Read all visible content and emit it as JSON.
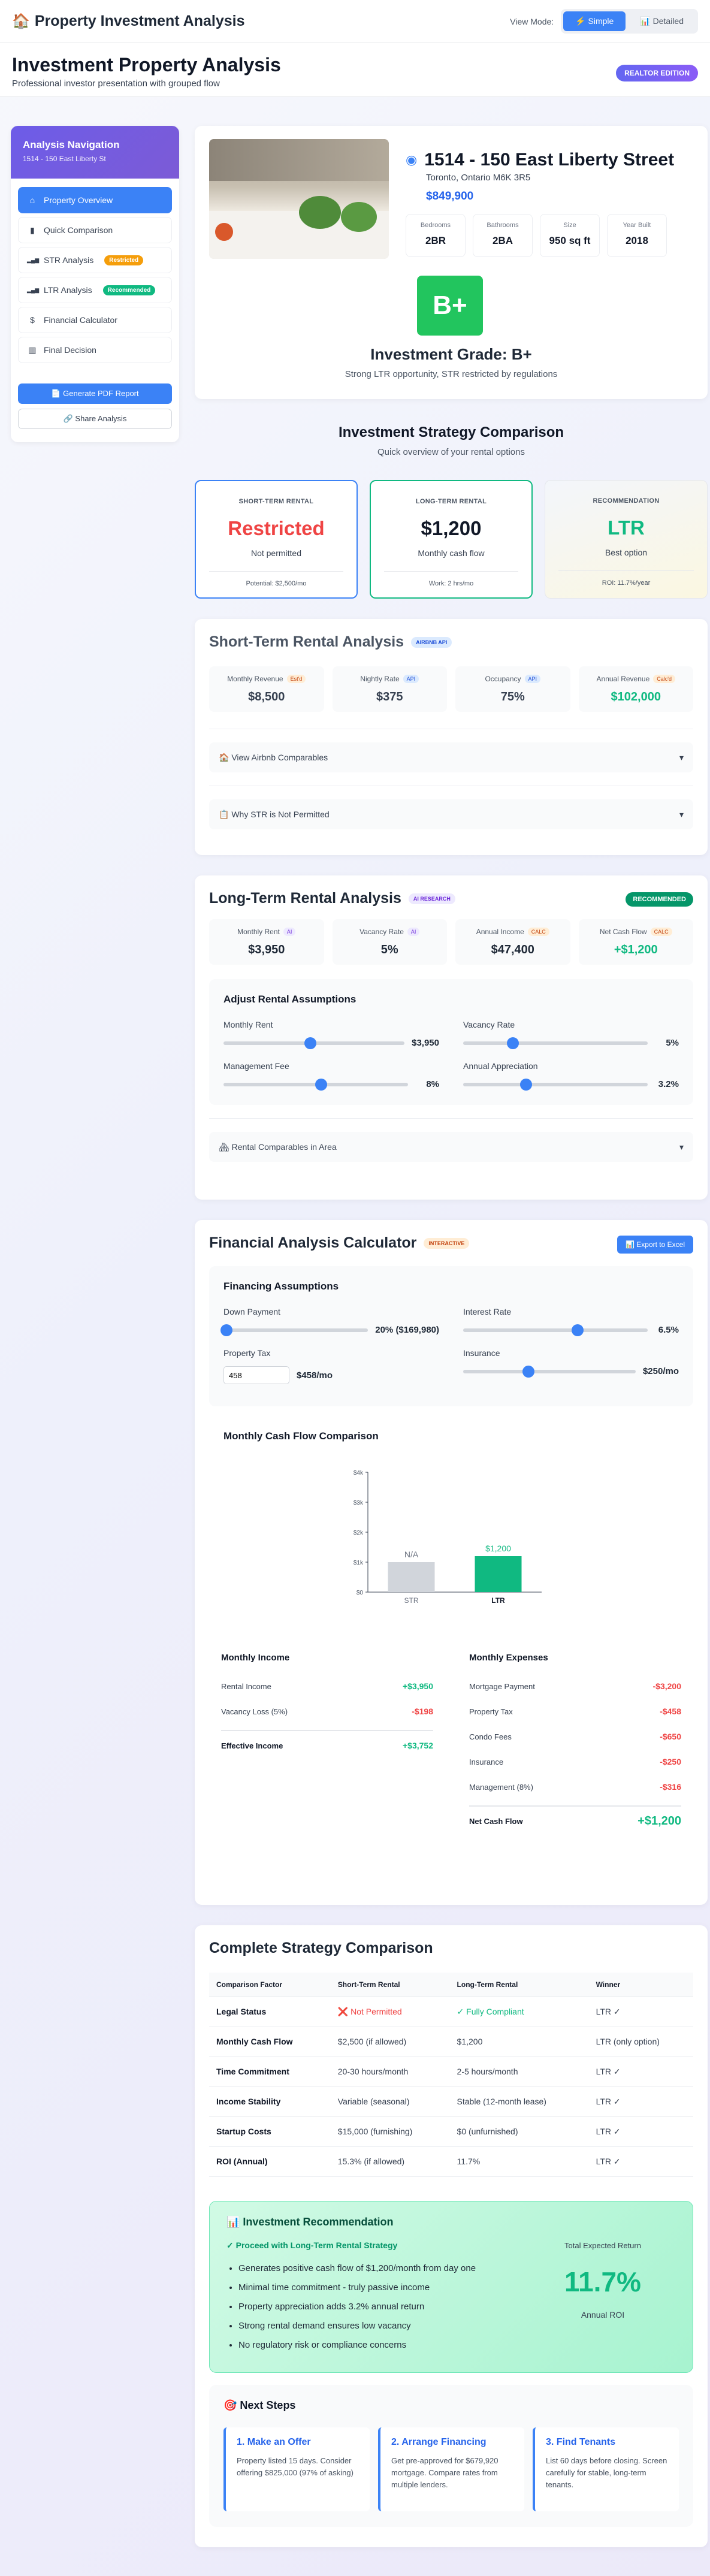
{
  "app": {
    "title": "Property Investment Analysis",
    "view_mode_label": "View Mode:",
    "modes": [
      "⚡ Simple",
      "📊 Detailed"
    ]
  },
  "header": {
    "title": "Investment Property Analysis",
    "subtitle": "Professional investor presentation with grouped flow",
    "badge": "REALTOR EDITION"
  },
  "sidebar": {
    "title": "Analysis Navigation",
    "subtitle": "1514 - 150 East Liberty St",
    "items": [
      {
        "label": "Property Overview",
        "icon": "home-icon",
        "glyph": "⌂"
      },
      {
        "label": "Quick Comparison",
        "icon": "clipboard-icon",
        "glyph": "▮"
      },
      {
        "label": "STR Analysis",
        "icon": "bar-chart-icon",
        "glyph": "▂▄▆",
        "badge": "Restricted"
      },
      {
        "label": "LTR Analysis",
        "icon": "bar-chart-icon",
        "glyph": "▂▄▆",
        "badge": "Recommended"
      },
      {
        "label": "Financial Calculator",
        "icon": "dollar-icon",
        "glyph": "$"
      },
      {
        "label": "Final Decision",
        "icon": "columns-icon",
        "glyph": "▥"
      }
    ],
    "pdf_button": "📄 Generate PDF Report",
    "share_button": "🔗 Share Analysis"
  },
  "property": {
    "address": "1514 - 150 East Liberty Street",
    "city": "Toronto, Ontario M6K 3R5",
    "price": "$849,900",
    "facts": [
      {
        "label": "Bedrooms",
        "value": "2BR"
      },
      {
        "label": "Bathrooms",
        "value": "2BA"
      },
      {
        "label": "Size",
        "value": "950 sq ft"
      },
      {
        "label": "Year Built",
        "value": "2018"
      }
    ],
    "grade": "B+",
    "grade_title": "Investment Grade: B+",
    "grade_sub": "Strong LTR opportunity, STR restricted by regulations"
  },
  "strategy": {
    "title": "Investment Strategy Comparison",
    "subtitle": "Quick overview of your rental options",
    "cards": [
      {
        "label": "SHORT-TERM RENTAL",
        "value": "Restricted",
        "desc": "Not permitted",
        "foot": "Potential: $2,500/mo",
        "color": "#ef4444"
      },
      {
        "label": "LONG-TERM RENTAL",
        "value": "$1,200",
        "desc": "Monthly cash flow",
        "foot": "Work: 2 hrs/mo",
        "color": "#111827"
      },
      {
        "label": "RECOMMENDATION",
        "value": "LTR",
        "desc": "Best option",
        "foot": "ROI: 11.7%/year",
        "color": "#10b981"
      }
    ]
  },
  "str": {
    "title": "Short-Term Rental Analysis",
    "tag": "AIRBNB API",
    "metrics": [
      {
        "label": "Monthly Revenue",
        "tag": "Est'd",
        "value": "$8,500"
      },
      {
        "label": "Nightly Rate",
        "tag": "API",
        "value": "$375"
      },
      {
        "label": "Occupancy",
        "tag": "API",
        "value": "75%"
      },
      {
        "label": "Annual Revenue",
        "tag": "Calc'd",
        "value": "$102,000"
      }
    ],
    "acc1": "🏠 View Airbnb Comparables",
    "acc2": "📋 Why STR is Not Permitted"
  },
  "ltr": {
    "title": "Long-Term Rental Analysis",
    "tag": "AI RESEARCH",
    "badge": "RECOMMENDED",
    "metrics": [
      {
        "label": "Monthly Rent",
        "tag": "AI",
        "value": "$3,950"
      },
      {
        "label": "Vacancy Rate",
        "tag": "AI",
        "value": "5%"
      },
      {
        "label": "Annual Income",
        "tag": "CALC",
        "value": "$47,400"
      },
      {
        "label": "Net Cash Flow",
        "tag": "CALC",
        "value": "+$1,200"
      }
    ],
    "panel_title": "Adjust Rental Assumptions",
    "sliders": [
      {
        "label": "Monthly Rent",
        "value": "$3,950",
        "level": 0.48
      },
      {
        "label": "Vacancy Rate",
        "value": "5%",
        "level": 0.27
      },
      {
        "label": "Management Fee",
        "value": "8%",
        "level": 0.53
      },
      {
        "label": "Annual Appreciation",
        "value": "3.2%",
        "level": 0.34
      }
    ],
    "acc": "🏘 Rental Comparables in Area"
  },
  "fin": {
    "title": "Financial Analysis Calculator",
    "tag": "INTERACTIVE",
    "export": "📊 Export to Excel",
    "panel_title": "Financing Assumptions",
    "down_label": "Down Payment",
    "down_value": "20% ($169,980)",
    "down_level": 0.02,
    "rate_label": "Interest Rate",
    "rate_value": "6.5%",
    "rate_level": 0.62,
    "tax_label": "Property Tax",
    "tax_input": "458",
    "tax_value": "$458/mo",
    "ins_label": "Insurance",
    "ins_value": "$250/mo",
    "ins_level": 0.38,
    "chart_title": "Monthly Cash Flow Comparison",
    "income_title": "Monthly Income",
    "income": [
      {
        "label": "Rental Income",
        "value": "+$3,950"
      },
      {
        "label": "Vacancy Loss (5%)",
        "value": "-$198"
      }
    ],
    "income_total": {
      "label": "Effective Income",
      "value": "+$3,752"
    },
    "expense_title": "Monthly Expenses",
    "expenses": [
      {
        "label": "Mortgage Payment",
        "value": "-$3,200"
      },
      {
        "label": "Property Tax",
        "value": "-$458"
      },
      {
        "label": "Condo Fees",
        "value": "-$650"
      },
      {
        "label": "Insurance",
        "value": "-$250"
      },
      {
        "label": "Management (8%)",
        "value": "-$316"
      }
    ],
    "expense_total": {
      "label": "Net Cash Flow",
      "value": "+$1,200"
    }
  },
  "chart_data": {
    "type": "bar",
    "title": "Monthly Cash Flow Comparison",
    "categories": [
      "STR",
      "LTR"
    ],
    "values": [
      1000,
      1200
    ],
    "data_labels": [
      "N/A",
      "$1,200"
    ],
    "colors": [
      "#d1d5db",
      "#10b981"
    ],
    "yticks": [
      "$0",
      "$1k",
      "$2k",
      "$3k",
      "$4k"
    ],
    "ylim": [
      0,
      4000
    ]
  },
  "compare": {
    "title": "Complete Strategy Comparison",
    "headers": [
      "Comparison Factor",
      "Short-Term Rental",
      "Long-Term Rental",
      "Winner"
    ],
    "rows": [
      [
        "Legal Status",
        "❌ Not Permitted",
        "✓ Fully Compliant",
        "LTR ✓"
      ],
      [
        "Monthly Cash Flow",
        "$2,500 (if allowed)",
        "$1,200",
        "LTR (only option)"
      ],
      [
        "Time Commitment",
        "20-30 hours/month",
        "2-5 hours/month",
        "LTR ✓"
      ],
      [
        "Income Stability",
        "Variable (seasonal)",
        "Stable (12-month lease)",
        "LTR ✓"
      ],
      [
        "Startup Costs",
        "$15,000 (furnishing)",
        "$0 (unfurnished)",
        "LTR ✓"
      ],
      [
        "ROI (Annual)",
        "15.3% (if allowed)",
        "11.7%",
        "LTR ✓"
      ]
    ]
  },
  "reco": {
    "title": "📊 Investment Recommendation",
    "proceed": "✓ Proceed with Long-Term Rental Strategy",
    "points": [
      "Generates positive cash flow of $1,200/month from day one",
      "Minimal time commitment - truly passive income",
      "Property appreciation adds 3.2% annual return",
      "Strong rental demand ensures low vacancy",
      "No regulatory risk or compliance concerns"
    ],
    "return_label": "Total Expected Return",
    "return_value": "11.7%",
    "return_sub": "Annual ROI"
  },
  "next": {
    "title": "🎯 Next Steps",
    "steps": [
      {
        "title": "1. Make an Offer",
        "desc": "Property listed 15 days. Consider offering $825,000 (97% of asking)"
      },
      {
        "title": "2. Arrange Financing",
        "desc": "Get pre-approved for $679,920 mortgage. Compare rates from multiple lenders."
      },
      {
        "title": "3. Find Tenants",
        "desc": "List 60 days before closing. Screen carefully for stable, long-term tenants."
      }
    ]
  }
}
